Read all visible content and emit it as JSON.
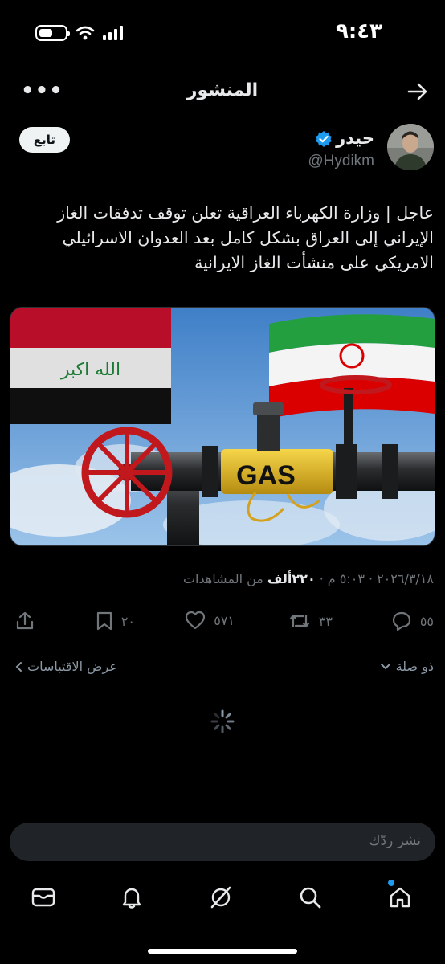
{
  "status_bar": {
    "time": "٩:٤٣"
  },
  "header": {
    "title": "المنشور"
  },
  "author": {
    "display_name": "حيدر",
    "handle": "@Hydikm",
    "follow_label": "تابع"
  },
  "post": {
    "text": "عاجل | وزارة الكهرباء العراقية تعلن توقف تدفقات الغاز الإيراني إلى العراق بشكل كامل بعد العدوان الاسرائيلي الامريكي على منشأت الغاز الايرانية",
    "image_label": "GAS"
  },
  "meta": {
    "date": "٢٠٢٦/٣/١٨",
    "time": "٥:٠٣ م",
    "views_count": "٢٢٠ألف",
    "views_label": "من المشاهدات",
    "separator": "·"
  },
  "actions": {
    "replies": "٥٥",
    "reposts": "٣٣",
    "likes": "٥٧١",
    "bookmarks": "٢٠"
  },
  "filters": {
    "reply_filter": "ذو صلة",
    "quotes": "عرض الاقتباسات"
  },
  "composer": {
    "placeholder": "نشر ردّك"
  },
  "colors": {
    "accent": "#1d9bf0",
    "background": "#000000",
    "muted": "#71767b"
  }
}
